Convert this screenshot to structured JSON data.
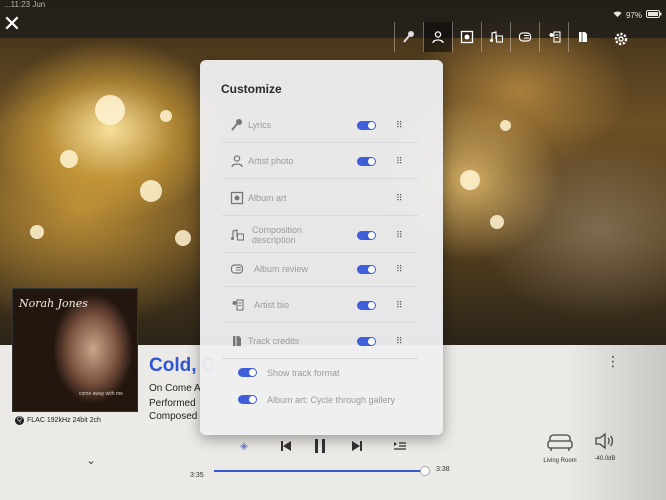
{
  "status_bar": {
    "left_text": "...11:23 Jun",
    "battery": "97%"
  },
  "view_bar": {
    "views": [
      {
        "id": "lyrics",
        "icon": "microphone-icon",
        "active": false
      },
      {
        "id": "artist-photo",
        "icon": "person-icon",
        "active": true
      },
      {
        "id": "album-art",
        "icon": "album-icon",
        "active": false
      },
      {
        "id": "composition",
        "icon": "composition-icon",
        "active": false
      },
      {
        "id": "album-review",
        "icon": "review-icon",
        "active": false
      },
      {
        "id": "artist-bio",
        "icon": "bio-icon",
        "active": false
      },
      {
        "id": "track-credits",
        "icon": "credits-icon",
        "active": false
      }
    ],
    "settings_icon": "gear-icon"
  },
  "customize": {
    "title": "Customize",
    "options": [
      {
        "label": "Lyrics",
        "icon": "microphone-icon",
        "toggle": true
      },
      {
        "label": "Artist photo",
        "icon": "person-icon",
        "toggle": true
      },
      {
        "label": "Album art",
        "icon": "album-icon",
        "toggle": false
      },
      {
        "label": "Composition description",
        "icon": "composition-icon",
        "toggle": true
      },
      {
        "label": "Album review",
        "icon": "review-icon",
        "toggle": true
      },
      {
        "label": "Artist bio",
        "icon": "bio-icon",
        "toggle": true
      },
      {
        "label": "Track credits",
        "icon": "credits-icon",
        "toggle": true
      }
    ],
    "sub_options": [
      {
        "label": "Show track format",
        "toggle": true
      },
      {
        "label": "Album art: Cycle through gallery",
        "toggle": true
      }
    ]
  },
  "now_playing": {
    "album_artist_script": "Norah Jones",
    "album_caption": "come away with me",
    "title": "Cold, C",
    "on_prefix": "On",
    "album": "Come A",
    "performed": "Performed",
    "composed": "Composed",
    "format_badge": "Q",
    "format": "FLAC 192kHz 24bit 2ch"
  },
  "transport": {
    "elapsed": "3:35",
    "total": "3:38",
    "progress": 0.985
  },
  "zone": {
    "label": "Living Room"
  },
  "volume": {
    "label": "-40.0dB"
  }
}
